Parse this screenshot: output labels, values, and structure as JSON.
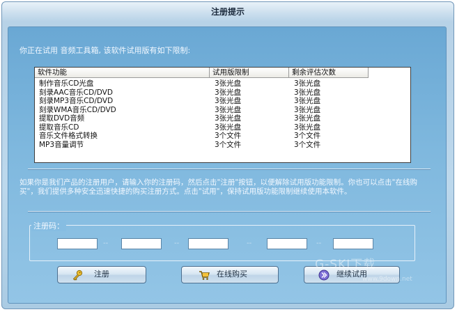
{
  "window": {
    "title": "注册提示"
  },
  "intro": "你正在试用 音频工具箱, 该软件试用版有如下限制:",
  "table": {
    "columns": [
      "软件功能",
      "试用版限制",
      "剩余评估次数"
    ],
    "rows": [
      [
        "制作音乐CD光盘",
        "3张光盘",
        "3张光盘"
      ],
      [
        "刻录AAC音乐CD/DVD",
        "3张光盘",
        "3张光盘"
      ],
      [
        "刻录MP3音乐CD/DVD",
        "3张光盘",
        "3张光盘"
      ],
      [
        "刻录WMA音乐CD/DVD",
        "3张光盘",
        "3张光盘"
      ],
      [
        "提取DVD音频",
        "3张光盘",
        "3张光盘"
      ],
      [
        "提取音乐CD",
        "3张光盘",
        "3张光盘"
      ],
      [
        "音乐文件格式转换",
        "3个文件",
        "3个文件"
      ],
      [
        "MP3音量调节",
        "3个文件",
        "3个文件"
      ]
    ]
  },
  "description": "如果你是我们产品的注册用户，请输入你的注册码，然后点击\"注册\"按钮，以便解除试用版功能限制。你也可以点击\"在线购买\"，我们提供多种安全迅速快捷的购买注册方式。点击\"试用\"，保持试用版功能限制继续使用本软件。",
  "registration": {
    "label": "注册码：",
    "fields": [
      "",
      "",
      "",
      "",
      ""
    ],
    "separator": "--"
  },
  "buttons": {
    "register": "注册",
    "buy_online": "在线购买",
    "continue_trial": "继续试用"
  },
  "icons": {
    "register": "key-icon",
    "buy_online": "shopping-cart-icon",
    "continue_trial": "continue-arrow-icon"
  },
  "watermark": {
    "logo": "G-SKI下载",
    "site": "www.9down.net"
  }
}
